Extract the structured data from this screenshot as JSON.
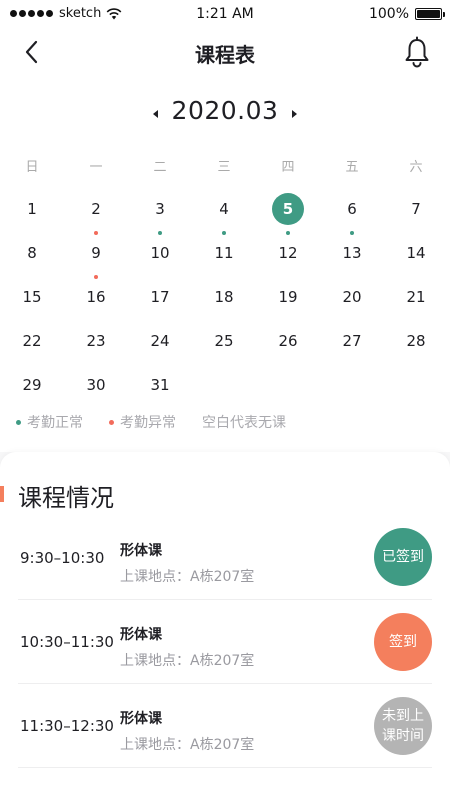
{
  "status_bar": {
    "carrier": "sketch",
    "time": "1:21 AM",
    "battery": "100%",
    "battery_level": 1.0
  },
  "nav": {
    "title": "课程表"
  },
  "calendar": {
    "month": "2020.03",
    "weekdays": [
      "日",
      "一",
      "二",
      "三",
      "四",
      "五",
      "六"
    ],
    "weeks": [
      [
        "1",
        "2",
        "3",
        "4",
        "5",
        "6",
        "7"
      ],
      [
        "8",
        "9",
        "10",
        "11",
        "12",
        "13",
        "14"
      ],
      [
        "15",
        "16",
        "17",
        "18",
        "19",
        "20",
        "21"
      ],
      [
        "22",
        "23",
        "24",
        "25",
        "26",
        "27",
        "28"
      ],
      [
        "29",
        "30",
        "31"
      ]
    ],
    "today": "5",
    "normal_days": [
      "3",
      "4",
      "5",
      "6"
    ],
    "abnormal_days": [
      "2",
      "9"
    ]
  },
  "legend": {
    "normal": "考勤正常",
    "abnormal": "考勤异常",
    "blank": "空白代表无课"
  },
  "colors": {
    "accent": "#3f9b84",
    "abnormal": "#f26b5b",
    "signin": "#f47f5d",
    "pending": "#b4b4b4",
    "title_bar": "#f47f5d"
  },
  "panel": {
    "title": "课程情况",
    "courses": [
      {
        "time": "9:30–10:30",
        "name": "形体课",
        "location": "上课地点：A栋207室",
        "action": "已签到",
        "state": "done"
      },
      {
        "time": "10:30–11:30",
        "name": "形体课",
        "location": "上课地点：A栋207室",
        "action": "签到",
        "state": "signin"
      },
      {
        "time": "11:30–12:30",
        "name": "形体课",
        "location": "上课地点：A栋207室",
        "action": "未到上课时间",
        "state": "pending"
      }
    ]
  }
}
